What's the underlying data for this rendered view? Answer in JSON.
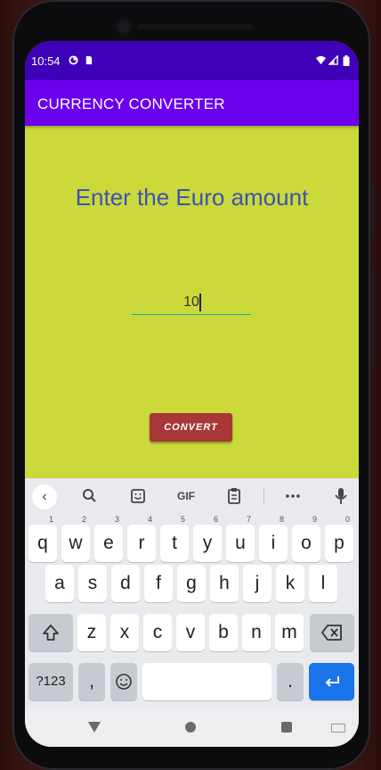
{
  "status_bar": {
    "time": "10:54",
    "icons": [
      "data-saver-icon",
      "sd-card-icon",
      "wifi-icon",
      "signal-icon",
      "battery-icon"
    ]
  },
  "app_bar": {
    "title": "CURRENCY CONVERTER"
  },
  "main": {
    "prompt": "Enter the Euro amount",
    "amount_value": "10",
    "convert_label": "CONVERT"
  },
  "keyboard": {
    "toolbar": [
      "back-chevron-icon",
      "search-icon",
      "sticker-icon",
      "gif-icon",
      "clipboard-icon",
      "more-icon",
      "mic-icon"
    ],
    "gif_label": "GIF",
    "row1": [
      {
        "k": "q",
        "n": "1"
      },
      {
        "k": "w",
        "n": "2"
      },
      {
        "k": "e",
        "n": "3"
      },
      {
        "k": "r",
        "n": "4"
      },
      {
        "k": "t",
        "n": "5"
      },
      {
        "k": "y",
        "n": "6"
      },
      {
        "k": "u",
        "n": "7"
      },
      {
        "k": "i",
        "n": "8"
      },
      {
        "k": "o",
        "n": "9"
      },
      {
        "k": "p",
        "n": "0"
      }
    ],
    "row2": [
      "a",
      "s",
      "d",
      "f",
      "g",
      "h",
      "j",
      "k",
      "l"
    ],
    "row3": [
      "z",
      "x",
      "c",
      "v",
      "b",
      "n",
      "m"
    ],
    "row4": {
      "symbols": "?123",
      "comma": ",",
      "period": "."
    }
  },
  "nav_bar": {
    "icons": [
      "back-icon",
      "home-icon",
      "recents-icon",
      "keyboard-switch-icon"
    ]
  },
  "colors": {
    "status_bar": "#3e01b8",
    "app_bar": "#6a00ee",
    "background": "#cbd93a",
    "prompt_text": "#3f51b5",
    "button": "#a83737",
    "underline": "#16a6a0",
    "enter_key": "#1a73e8"
  }
}
